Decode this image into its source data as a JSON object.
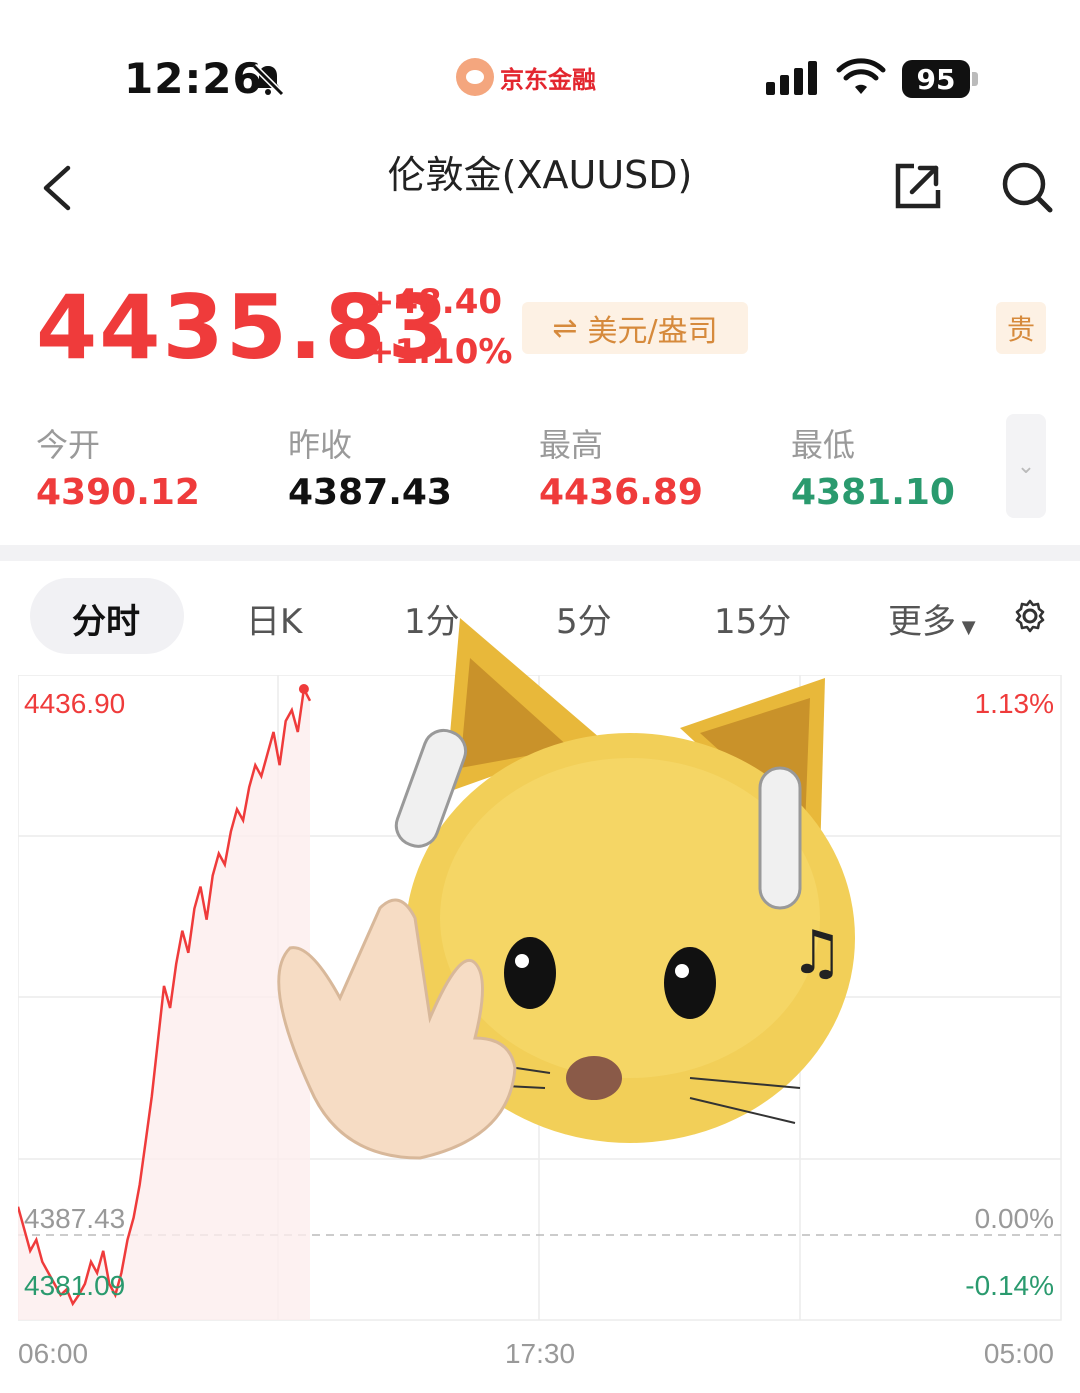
{
  "status_bar": {
    "time": "12:26",
    "app_name": "京东金融",
    "battery": "95",
    "icons": [
      "bell-mute-icon",
      "cellular-signal-icon",
      "wifi-icon",
      "battery-icon"
    ]
  },
  "header": {
    "title": "伦敦金(XAUUSD)",
    "icons": [
      "back-chevron-icon",
      "share-icon",
      "search-icon"
    ]
  },
  "quote": {
    "price": "4435.83",
    "change": "+48.40",
    "change_pct": "+1.10%",
    "currency_toggle": "美元/盎司",
    "metal_tag": "贵",
    "colors": {
      "up": "#ef3b3b",
      "down": "#2a9a6e"
    }
  },
  "stats": [
    {
      "label": "今开",
      "value": "4390.12",
      "color": "#ef3b3b"
    },
    {
      "label": "昨收",
      "value": "4387.43",
      "color": "#111111"
    },
    {
      "label": "最高",
      "value": "4436.89",
      "color": "#ef3b3b"
    },
    {
      "label": "最低",
      "value": "4381.10",
      "color": "#2a9a6e"
    }
  ],
  "tabs": [
    "分时",
    "日K",
    "1分",
    "5分",
    "15分",
    "更多"
  ],
  "active_tab": "分时",
  "chart_labels": {
    "left_top": "4436.90",
    "left_mid": "4387.43",
    "left_bottom": "4381.09",
    "right_top": "1.13%",
    "right_mid": "0.00%",
    "right_bottom": "-0.14%",
    "x_start": "06:00",
    "x_mid": "17:30",
    "x_end": "05:00"
  },
  "chart_data": {
    "type": "line",
    "series": [
      {
        "values": [
          4390,
          4388,
          4386,
          4387,
          4385,
          4384,
          4383,
          4382,
          4382.5,
          4381.2,
          4382,
          4383,
          4385,
          4384,
          4386,
          4383,
          4382,
          4384,
          4387,
          4389,
          4392,
          4396,
          4400,
          4405,
          4410,
          4408,
          4412,
          4415,
          4413,
          4417,
          4419,
          4416,
          4420,
          4422,
          4421,
          4424,
          4426,
          4425,
          4428,
          4430,
          4429,
          4431,
          4433,
          4430,
          4434,
          4435,
          4433,
          4436.9,
          4435.83
        ]
      }
    ],
    "ylim": [
      4381.09,
      4436.9
    ],
    "reference": 4387.43
  }
}
